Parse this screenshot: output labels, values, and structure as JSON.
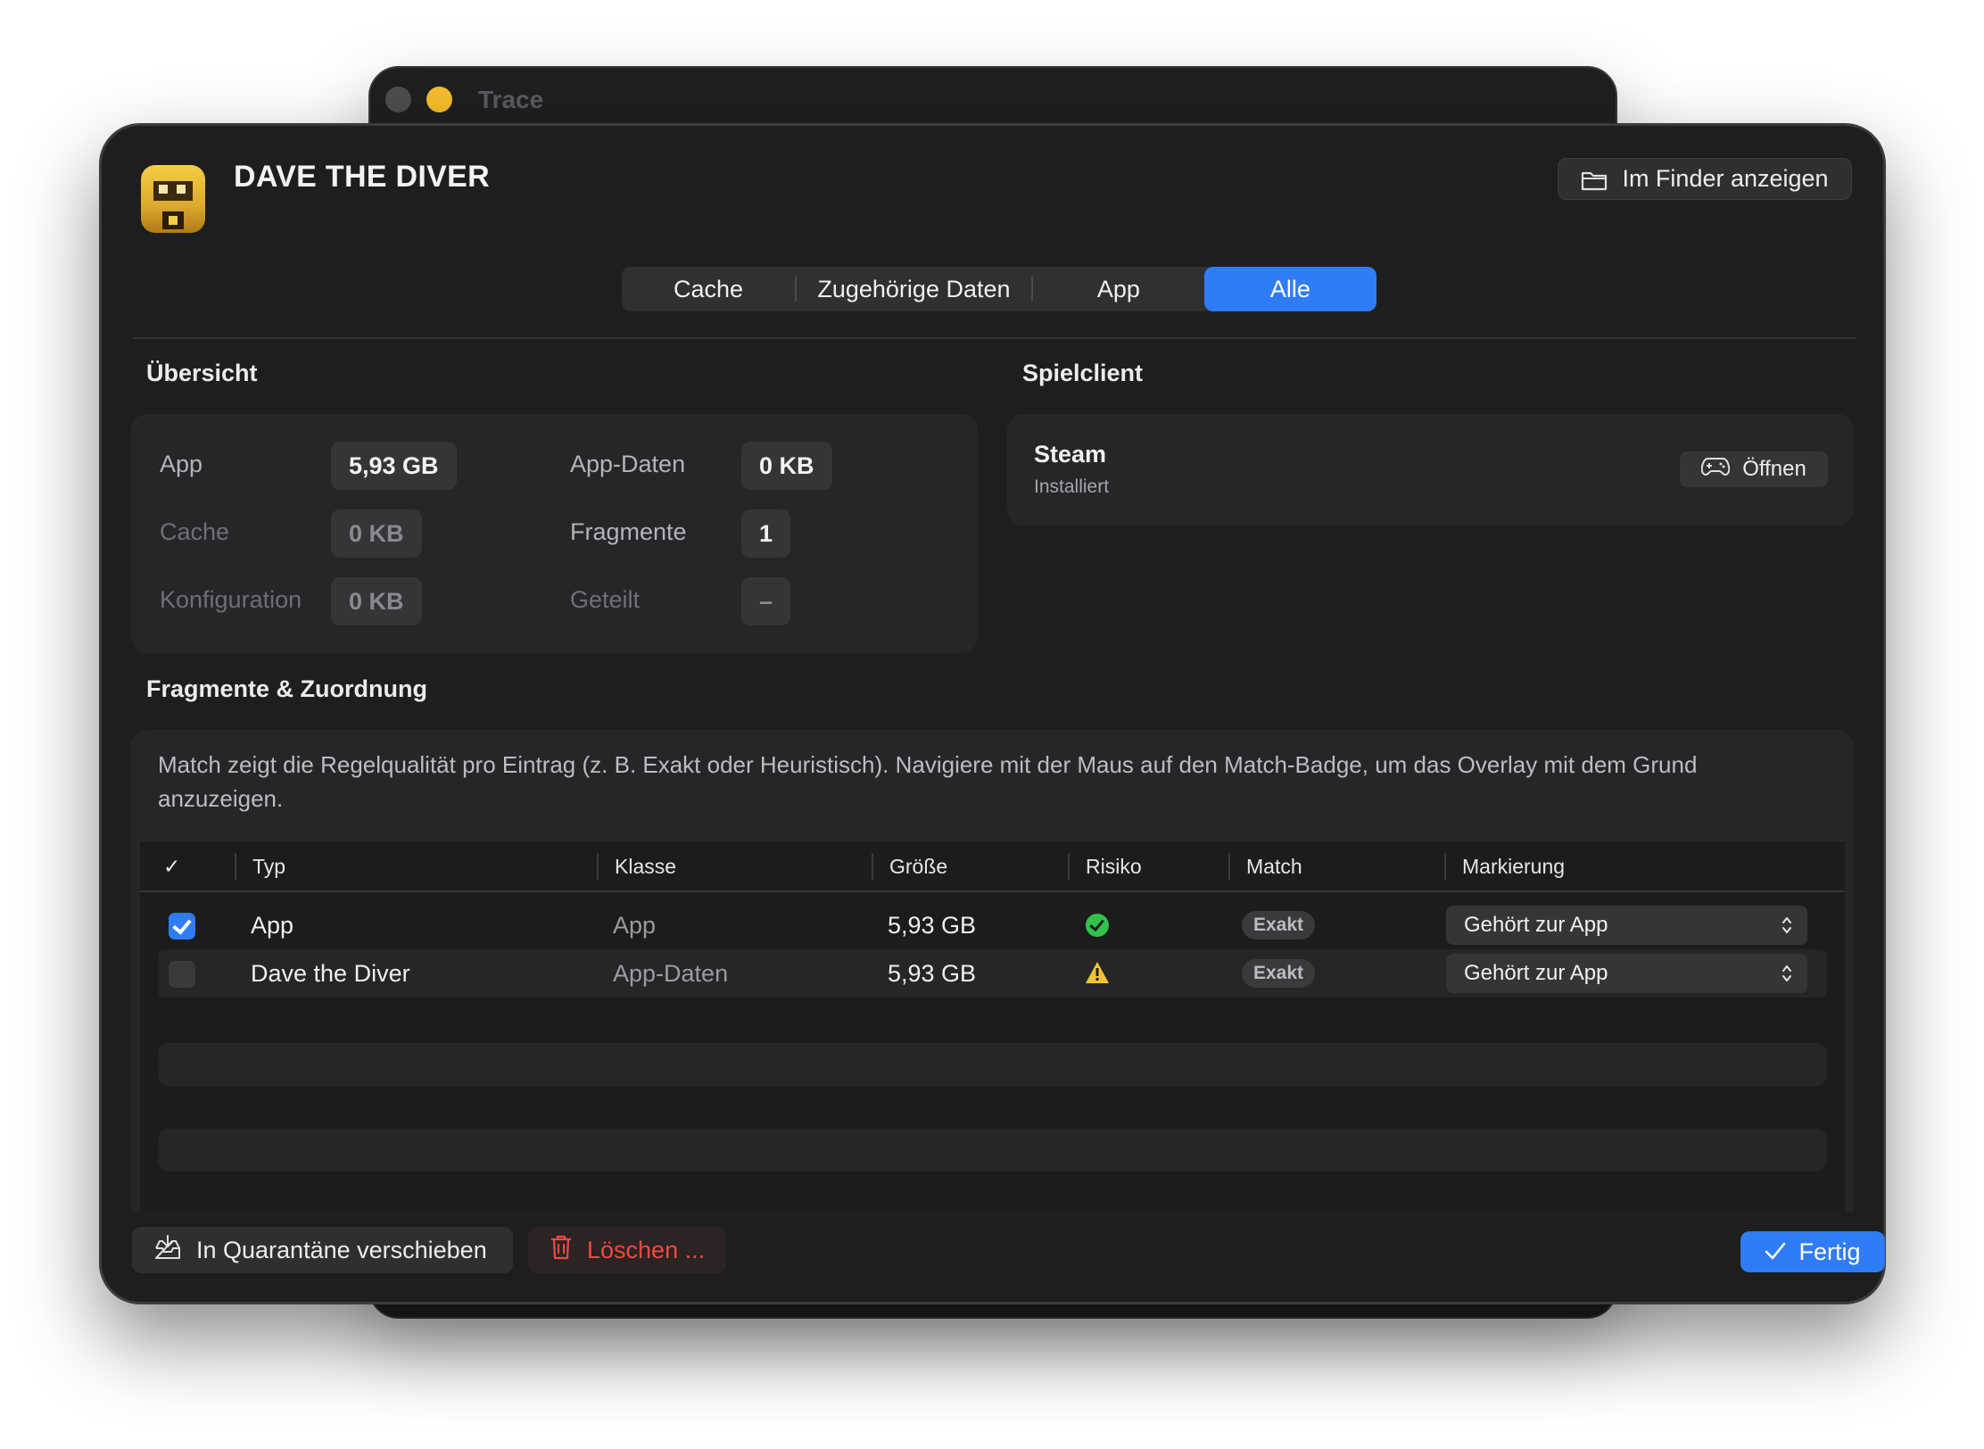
{
  "background_window": {
    "title": "Trace"
  },
  "header": {
    "app_name": "DAVE THE DIVER",
    "finder_button": "Im Finder anzeigen"
  },
  "tabs": [
    {
      "label": "Cache",
      "selected": false
    },
    {
      "label": "Zugehörige Daten",
      "selected": false
    },
    {
      "label": "App",
      "selected": false
    },
    {
      "label": "Alle",
      "selected": true
    }
  ],
  "overview": {
    "title": "Übersicht",
    "items": [
      {
        "label": "App",
        "value": "5,93 GB"
      },
      {
        "label": "App-Daten",
        "value": "0 KB"
      },
      {
        "label": "Cache",
        "value": "0 KB"
      },
      {
        "label": "Fragmente",
        "value": "1"
      },
      {
        "label": "Konfiguration",
        "value": "0 KB"
      },
      {
        "label": "Geteilt",
        "value": "–"
      }
    ]
  },
  "client": {
    "title": "Spielclient",
    "name": "Steam",
    "status": "Installiert",
    "open_button": "Öffnen"
  },
  "fragments": {
    "title": "Fragmente & Zuordnung",
    "description": "Match zeigt die Regelqualität pro Eintrag (z. B. Exakt oder Heuristisch). Navigiere mit der Maus auf den Match-Badge, um das Overlay mit dem Grund anzuzeigen.",
    "columns": [
      "✓",
      "Typ",
      "Klasse",
      "Größe",
      "Risiko",
      "Match",
      "Markierung"
    ],
    "rows": [
      {
        "checked": true,
        "typ": "App",
        "klasse": "App",
        "groesse": "5,93 GB",
        "risiko": "ok",
        "match": "Exakt",
        "markierung": "Gehört zur App"
      },
      {
        "checked": false,
        "typ": "Dave the Diver",
        "klasse": "App-Daten",
        "groesse": "5,93 GB",
        "risiko": "warning",
        "match": "Exakt",
        "markierung": "Gehört zur App"
      }
    ]
  },
  "footer": {
    "quarantine_button": "In Quarantäne verschieben",
    "delete_button": "Löschen ...",
    "done_button": "Fertig"
  },
  "colors": {
    "accent": "#2f7cf6",
    "danger": "#f04a40",
    "ok": "#30c24a",
    "warning": "#f4c430"
  }
}
